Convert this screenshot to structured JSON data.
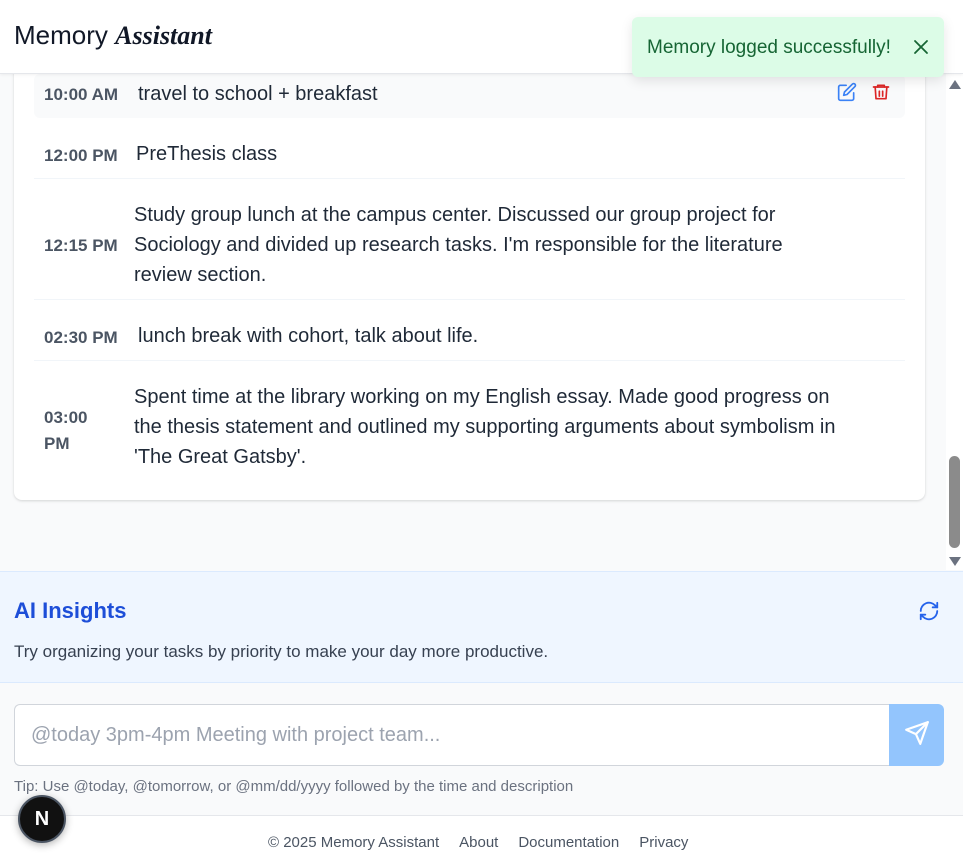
{
  "header": {
    "title_part1": "Memory",
    "title_part2": "Assistant"
  },
  "toast": {
    "message": "Memory logged successfully!",
    "close_icon": "close-icon"
  },
  "timeline": {
    "entries": [
      {
        "time": "10:00 AM",
        "description": "travel to school + breakfast",
        "highlighted": true
      },
      {
        "time": "12:00 PM",
        "description": "PreThesis class"
      },
      {
        "time": "12:15 PM",
        "description": "Study group lunch at the campus center. Discussed our group project for Sociology and divided up research tasks. I'm responsible for the literature review section."
      },
      {
        "time": "02:30 PM",
        "description": "lunch break with cohort, talk about life."
      },
      {
        "time": "03:00 PM",
        "description": "Spent time at the library working on my English essay. Made good progress on the thesis statement and outlined my supporting arguments about symbolism in 'The Great Gatsby'."
      }
    ],
    "edit_icon": "edit-icon",
    "delete_icon": "trash-icon"
  },
  "insights": {
    "title": "AI Insights",
    "text": "Try organizing your tasks by priority to make your day more productive.",
    "refresh_icon": "refresh-icon"
  },
  "composer": {
    "placeholder": "@today 3pm-4pm Meeting with project team...",
    "value": "",
    "send_icon": "send-icon",
    "tip": "Tip: Use @today, @tomorrow, or @mm/dd/yyyy followed by the time and description"
  },
  "footer": {
    "copyright": "© 2025 Memory Assistant",
    "links": [
      "About",
      "Documentation",
      "Privacy"
    ]
  },
  "badge": {
    "letter": "N"
  },
  "colors": {
    "accent": "#1d4ed8",
    "toast_bg": "#dcfce7",
    "toast_text": "#166534",
    "send_button": "#93c5fd",
    "delete_red": "#dc2626",
    "edit_blue": "#3b82f6",
    "insights_bg": "#eff6ff"
  }
}
